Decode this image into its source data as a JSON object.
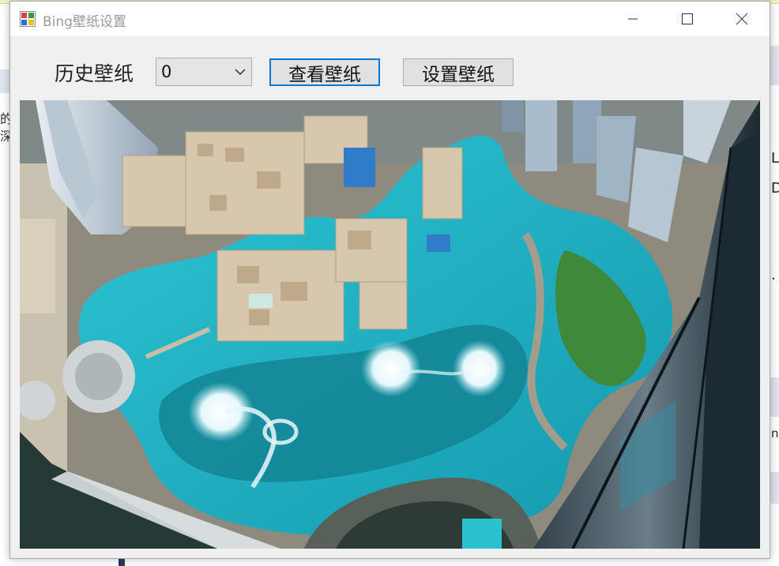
{
  "window": {
    "title": "Bing壁纸设置"
  },
  "controls": {
    "history_label": "历史壁纸",
    "history_value": "0",
    "view_button": "查看壁纸",
    "set_button": "设置壁纸"
  },
  "background": {
    "left_text": [
      "的",
      "深"
    ],
    "right_glyphs": [
      "L",
      "D",
      "·",
      "ns"
    ]
  },
  "colors": {
    "accent": "#0078d7",
    "window_bg": "#f0f0f0",
    "water": "#1fb2c4"
  }
}
